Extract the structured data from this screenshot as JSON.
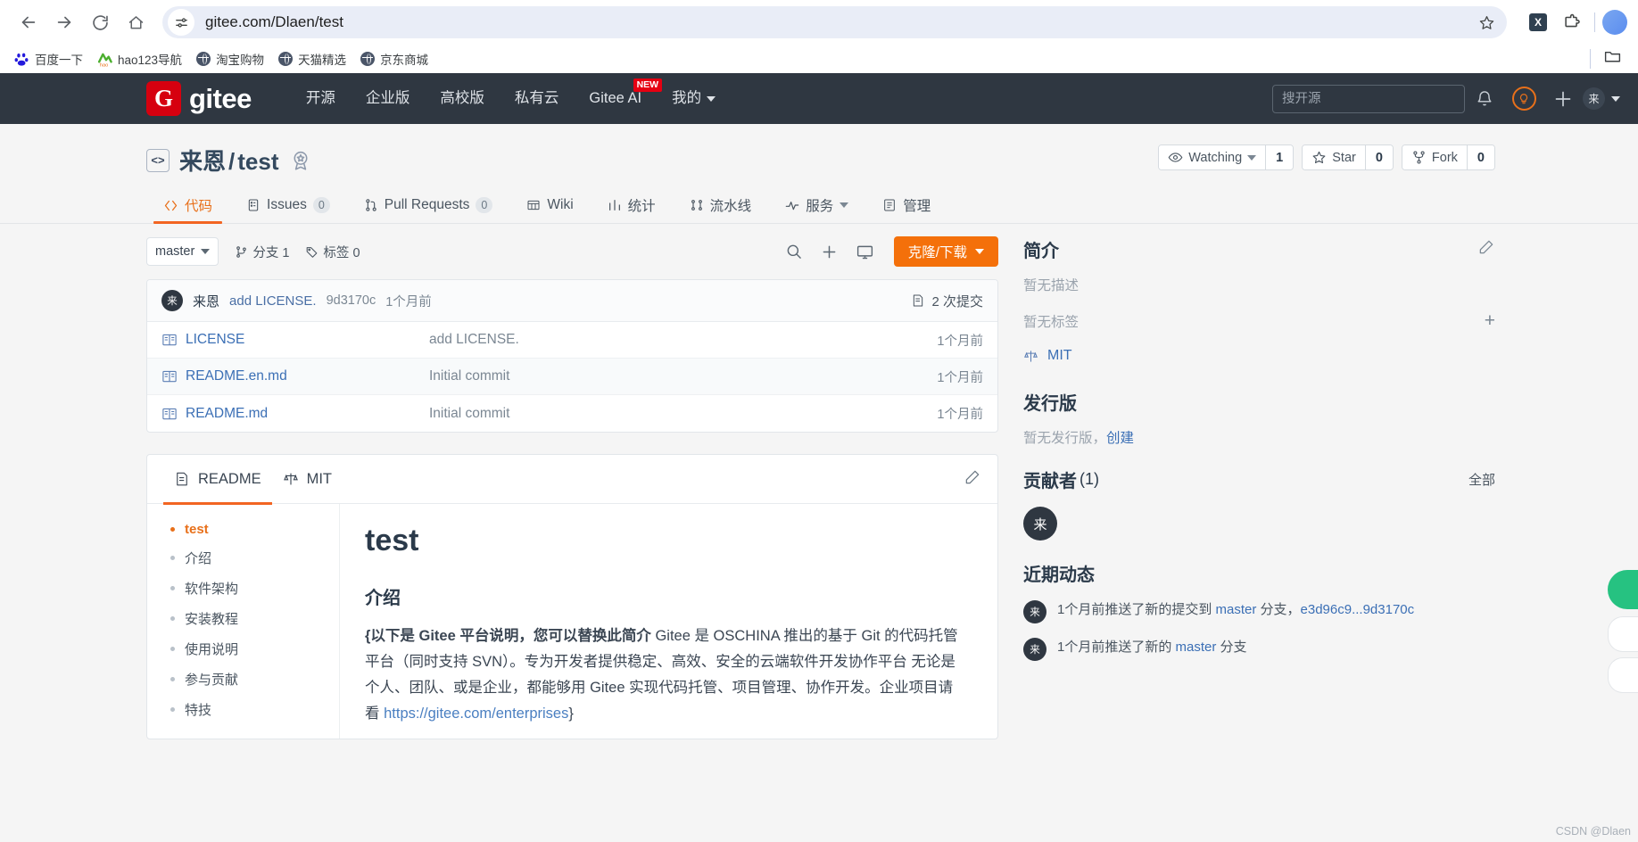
{
  "browser": {
    "back_icon": "back-arrow-icon",
    "forward_icon": "forward-arrow-icon",
    "reload_icon": "reload-icon",
    "home_icon": "home-icon",
    "url": "gitee.com/Dlaen/test",
    "site_info_icon": "site-settings-icon",
    "bookmark_star_icon": "star-outline-icon",
    "extension_x_label": "X",
    "extensions_icon": "puzzle-piece-icon",
    "bookmarks": [
      {
        "label": "百度一下",
        "icon": "baidu-icon"
      },
      {
        "label": "hao123导航",
        "icon": "hao123-icon"
      },
      {
        "label": "淘宝购物",
        "icon": "globe-icon"
      },
      {
        "label": "天猫精选",
        "icon": "globe-icon"
      },
      {
        "label": "京东商城",
        "icon": "globe-icon"
      }
    ],
    "bookmark_folder_icon": "folder-icon"
  },
  "gitee_header": {
    "logo_mark": "G",
    "logo_text": "gitee",
    "nav": [
      {
        "label": "开源",
        "badge": ""
      },
      {
        "label": "企业版",
        "badge": ""
      },
      {
        "label": "高校版",
        "badge": ""
      },
      {
        "label": "私有云",
        "badge": ""
      },
      {
        "label": "Gitee AI",
        "badge": "NEW"
      },
      {
        "label": "我的",
        "badge": "",
        "caret": true
      }
    ],
    "search_placeholder": "搜开源",
    "bell_icon": "notification-bell-icon",
    "bulb_icon": "lightbulb-icon",
    "plus_icon": "plus-icon",
    "user_initial": "来",
    "accent_color": "#f26522",
    "header_bg": "#2f3741"
  },
  "repo": {
    "owner": "来恩",
    "name": "test",
    "code_badge_icon": "code-brackets-icon",
    "certified_icon": "badge-star-icon",
    "actions": [
      {
        "icon": "eye-icon",
        "label": "Watching",
        "caret": true,
        "count": "1",
        "name": "watch"
      },
      {
        "icon": "star-icon",
        "label": "Star",
        "caret": false,
        "count": "0",
        "name": "star"
      },
      {
        "icon": "fork-icon",
        "label": "Fork",
        "caret": false,
        "count": "0",
        "name": "fork"
      }
    ],
    "tabs": [
      {
        "label": "代码",
        "icon": "code-icon",
        "count": "",
        "active": true
      },
      {
        "label": "Issues",
        "icon": "issues-icon",
        "count": "0",
        "active": false
      },
      {
        "label": "Pull Requests",
        "icon": "pull-request-icon",
        "count": "0",
        "active": false
      },
      {
        "label": "Wiki",
        "icon": "wiki-icon",
        "count": "",
        "active": false
      },
      {
        "label": "统计",
        "icon": "stats-icon",
        "count": "",
        "active": false
      },
      {
        "label": "流水线",
        "icon": "pipeline-icon",
        "count": "",
        "active": false
      },
      {
        "label": "服务",
        "icon": "service-icon",
        "count": "",
        "active": false,
        "caret": true
      },
      {
        "label": "管理",
        "icon": "manage-icon",
        "count": "",
        "active": false
      }
    ]
  },
  "file_toolbar": {
    "branch": "master",
    "branch_icon": "branch-icon",
    "branches_label": "分支 1",
    "tags_icon": "tag-icon",
    "tags_label": "标签 0",
    "search_icon": "search-icon",
    "plus_icon": "plus-icon",
    "terminal_icon": "monitor-icon",
    "clone_label": "克隆/下载",
    "clone_color": "#f4700a"
  },
  "commit_bar": {
    "avatar_initial": "来",
    "author": "来恩",
    "message": "add LICENSE.",
    "sha": "9d3170c",
    "time": "1个月前",
    "commits_icon": "commit-list-icon",
    "commits_label": "2 次提交"
  },
  "files": [
    {
      "icon": "book-icon",
      "name": "LICENSE",
      "message": "add LICENSE.",
      "time": "1个月前"
    },
    {
      "icon": "book-icon",
      "name": "README.en.md",
      "message": "Initial commit",
      "time": "1个月前"
    },
    {
      "icon": "book-icon",
      "name": "README.md",
      "message": "Initial commit",
      "time": "1个月前"
    }
  ],
  "readme": {
    "tabs": [
      {
        "label": "README",
        "icon": "readme-icon",
        "active": true
      },
      {
        "label": "MIT",
        "icon": "license-scale-icon",
        "active": false
      }
    ],
    "edit_icon": "edit-pencil-icon",
    "toc": [
      {
        "label": "test",
        "top": true
      },
      {
        "label": "介绍",
        "top": false
      },
      {
        "label": "软件架构",
        "top": false
      },
      {
        "label": "安装教程",
        "top": false
      },
      {
        "label": "使用说明",
        "top": false
      },
      {
        "label": "参与贡献",
        "top": false
      },
      {
        "label": "特技",
        "top": false
      }
    ],
    "h1": "test",
    "h2": "介绍",
    "para_bold": "{以下是 Gitee 平台说明，您可以替换此简介",
    "para_rest_1": " Gitee 是 OSCHINA 推出的基于 Git 的代码托管平台（同时支持 SVN）。专为开发者提供稳定、高效、安全的云端软件开发协作平台 无论是个人、团队、或是企业，都能够用 Gitee 实现代码托管、项目管理、协作开发。企业项目请看 ",
    "para_link": "https://gitee.com/enterprises",
    "para_rest_2": "}"
  },
  "sidebar": {
    "intro_title": "简介",
    "intro_edit_icon": "edit-pencil-icon",
    "no_description": "暂无描述",
    "no_tags": "暂无标签",
    "add_tag_icon": "plus-icon",
    "license_icon": "license-scale-icon",
    "license": "MIT",
    "releases_title": "发行版",
    "releases_none": "暂无发行版，",
    "releases_create": "创建",
    "contributors_title": "贡献者",
    "contributors_count": "(1)",
    "contributors_all": "全部",
    "contributor_initial": "来",
    "activity_title": "近期动态",
    "activities": [
      {
        "avatar": "来",
        "text_before": "1个月前推送了新的提交到 ",
        "link1": "master",
        "text_mid": " 分支，",
        "link2": "e3d96c9...9d3170c",
        "text_after": ""
      },
      {
        "avatar": "来",
        "text_before": "1个月前推送了新的 ",
        "link1": "master",
        "text_mid": " 分支",
        "link2": "",
        "text_after": ""
      }
    ]
  },
  "watermark": "CSDN @Dlaen"
}
